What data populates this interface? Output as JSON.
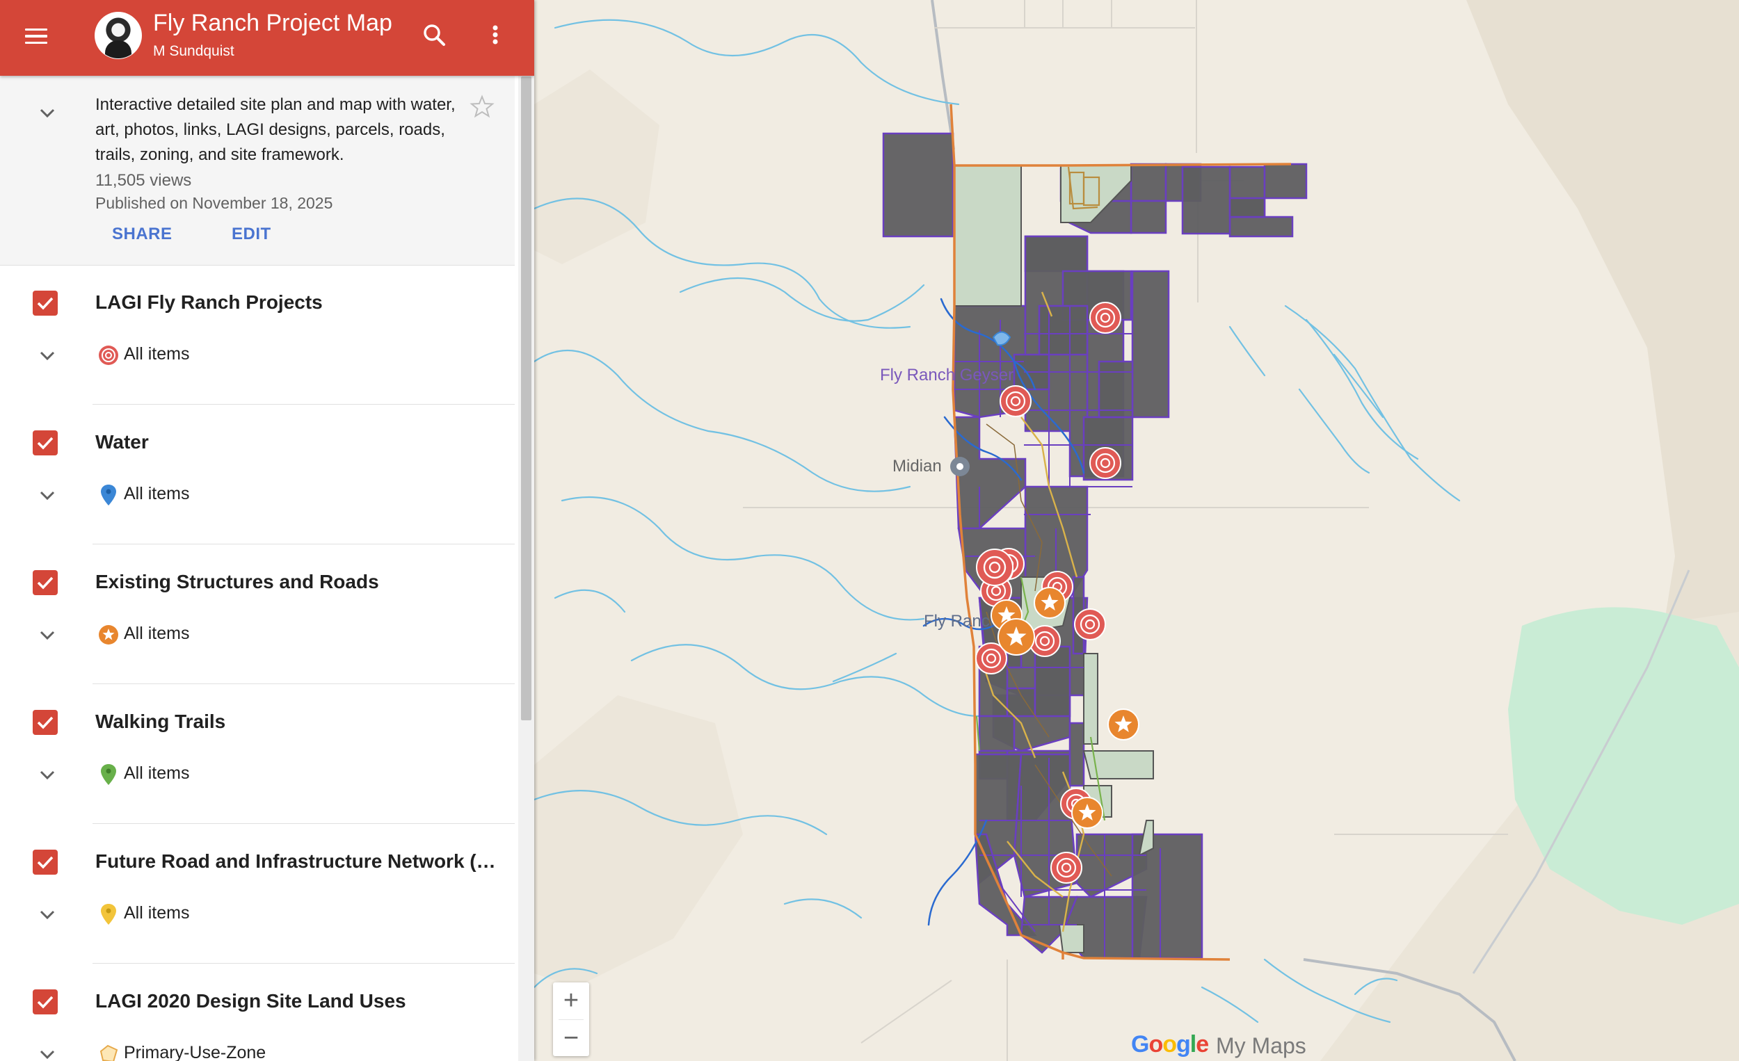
{
  "header": {
    "title": "Fly Ranch Project Map",
    "author": "M Sundquist"
  },
  "description": {
    "text": "Interactive detailed site plan and map with water, art, photos, links, LAGI designs, parcels, roads, trails, zoning, and site framework.",
    "views": "11,505 views",
    "published": "Published on November 18, 2025",
    "share_label": "SHARE",
    "edit_label": "EDIT"
  },
  "layers": [
    {
      "name": "LAGI Fly Ranch Projects",
      "item_label": "All items",
      "icon": "target-icon"
    },
    {
      "name": "Water",
      "item_label": "All items",
      "icon": "blue-pin-icon"
    },
    {
      "name": "Existing Structures and Roads",
      "item_label": "All items",
      "icon": "orange-star-icon"
    },
    {
      "name": "Walking Trails",
      "item_label": "All items",
      "icon": "green-pin-icon"
    },
    {
      "name": "Future Road and Infrastructure Network (…",
      "item_label": "All items",
      "icon": "yellow-pin-icon"
    },
    {
      "name": "LAGI 2020 Design Site Land Uses",
      "item_label": "Primary-Use-Zone",
      "icon": "polygon-icon"
    }
  ],
  "map": {
    "labels": {
      "fly_ranch_geyser": "Fly Ranch Geyser",
      "midian": "Midian",
      "fly_ranch": "Fly Ranch"
    },
    "zoom_in": "+",
    "zoom_out": "−",
    "brand_google": "Google",
    "brand_mymaps": "My Maps"
  },
  "colors": {
    "header": "#d44638",
    "link": "#4a74d0",
    "parcel_fill": "#5e5e60",
    "parcel_outline": "#6a3fc0",
    "boundary": "#e0823a",
    "water": "#5eb4dc",
    "target_marker": "#e05a55",
    "star_marker": "#e8862e"
  }
}
